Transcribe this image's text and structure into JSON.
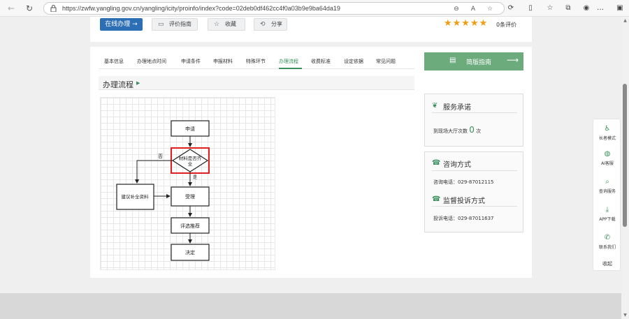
{
  "browser": {
    "url": "https://zwfw.yangling.gov.cn/yangling/icity/proinfo/index?code=02deb0df462cc4f0a03b9e9ba64da19",
    "icons": [
      "back-icon",
      "refresh-icon",
      "zoom-icon",
      "read-aloud-icon",
      "favorite-icon",
      "extensions-icon",
      "split-screen-icon",
      "favorites-icon",
      "collections-icon",
      "profile-icon",
      "sidebar-icon"
    ]
  },
  "top": {
    "apply_label": "在线办理 →",
    "guide_label": "评价指南",
    "favorite_label": "收藏",
    "share_label": "分享",
    "stars": 5,
    "rating_text": "0条评价"
  },
  "tabs": [
    "基本信息",
    "办理地点时间",
    "申请条件",
    "申报材料",
    "特殊环节",
    "办理流程",
    "收费标准",
    "设定依据",
    "常见问题"
  ],
  "active_tab": "办理流程",
  "section": {
    "title": "办理流程"
  },
  "flow": {
    "apply": "申请",
    "check": "材料是否齐全",
    "no": "否",
    "yes": "是",
    "supplement": "建议补全资料",
    "accept": "受理",
    "review": "评选推荐",
    "decide": "决定"
  },
  "right": {
    "quick_guide": "简版指南",
    "commit_title": "服务承诺",
    "visits_prefix": "到现场大厅次数",
    "visits_count": "0",
    "visits_suffix": "次",
    "consult_title": "咨询方式",
    "consult_phone": "咨询电话：029-87012115",
    "complaint_title": "监督投诉方式",
    "complaint_phone": "投诉电话：029-87011637"
  },
  "float_toolbar": [
    {
      "label": "长者模式",
      "icon": "elder-mode-icon"
    },
    {
      "label": "AI客服",
      "icon": "ai-service-icon"
    },
    {
      "label": "查询服务",
      "icon": "query-icon"
    },
    {
      "label": "APP下载",
      "icon": "download-icon"
    },
    {
      "label": "联系我们",
      "icon": "phone-icon"
    },
    {
      "label": "收起",
      "icon": ""
    }
  ],
  "colors": {
    "primary": "#2d6fb4",
    "accent_green": "#3a8f5c",
    "guide_green": "#6bab7c",
    "star": "#f39c12",
    "highlight_red": "#e02020"
  }
}
